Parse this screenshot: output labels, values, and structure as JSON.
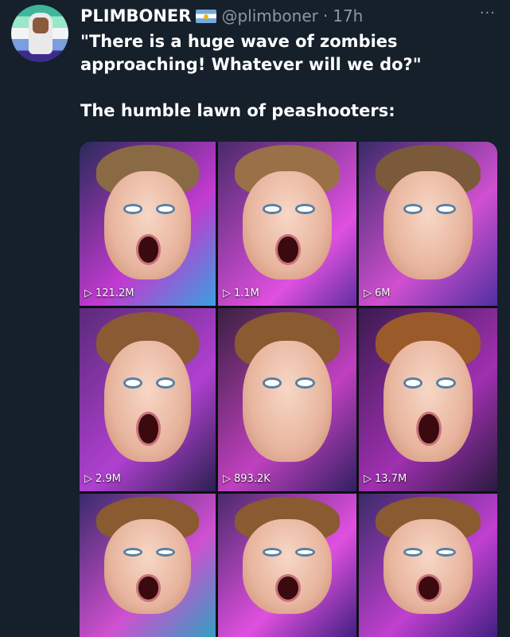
{
  "tweet": {
    "display_name": "PLIMBONER",
    "handle": "@plimboner",
    "separator": "·",
    "time": "17h",
    "more": "···",
    "line1": "\"There is a huge wave of zombies approaching! Whatever will we do?\"",
    "line2": "The humble lawn of peashooters:"
  },
  "icons": {
    "avatar": "toilet-avatar-icon",
    "flag": "argentina-flag-icon",
    "more": "more-icon",
    "play": "play-icon"
  },
  "colors": {
    "background": "#15202b",
    "muted": "#8b98a5",
    "text": "#ffffff"
  },
  "media": {
    "tiles": [
      {
        "views": "121.2M",
        "play": "▷"
      },
      {
        "views": "1.1M",
        "play": "▷"
      },
      {
        "views": "6M",
        "play": "▷"
      },
      {
        "views": "2.9M",
        "play": "▷"
      },
      {
        "views": "893.2K",
        "play": "▷"
      },
      {
        "views": "13.7M",
        "play": "▷"
      },
      {
        "views": "",
        "play": ""
      },
      {
        "views": "",
        "play": ""
      },
      {
        "views": "",
        "play": ""
      }
    ]
  }
}
